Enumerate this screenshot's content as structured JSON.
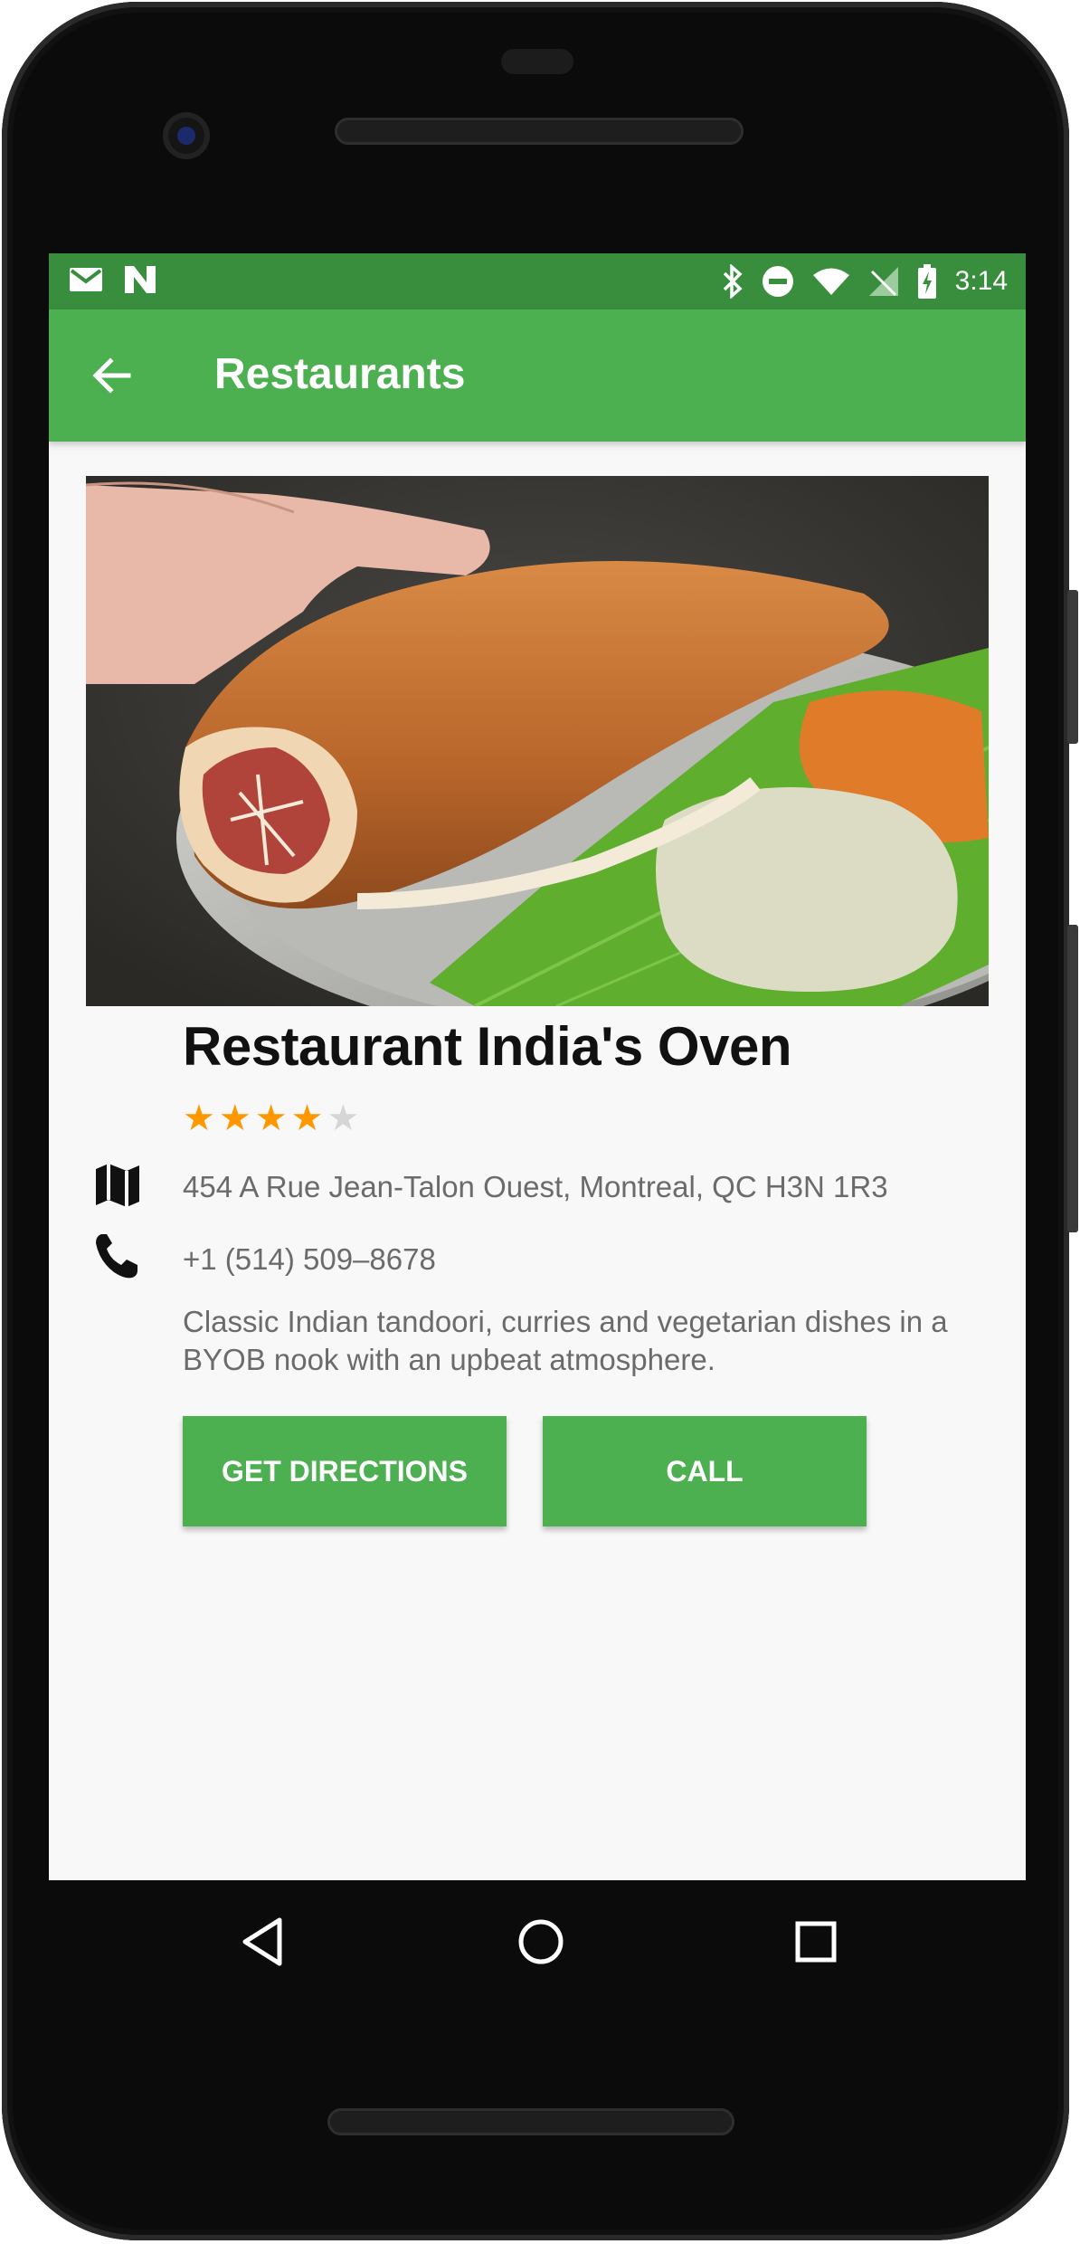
{
  "status_bar": {
    "time": "3:14",
    "icons_left": [
      "gmail-icon",
      "n-notification-icon"
    ],
    "icons_right": [
      "bluetooth-icon",
      "do-not-disturb-icon",
      "wifi-icon",
      "no-signal-icon",
      "battery-charging-icon"
    ]
  },
  "app_bar": {
    "title": "Restaurants",
    "back_icon": "arrow-back-icon",
    "color": "#4caf50",
    "status_color": "#388e3c"
  },
  "restaurant": {
    "name": "Restaurant India's Oven",
    "rating": 4,
    "rating_max": 5,
    "address": "454 A Rue Jean-Talon Ouest, Montreal, QC H3N 1R3",
    "phone": "+1 (514) 509–8678",
    "description": "Classic Indian tandoori, curries and vegetarian dishes in a BYOB nook with an upbeat atmosphere.",
    "image": "masala-dosa-photo"
  },
  "actions": {
    "directions_label": "GET DIRECTIONS",
    "call_label": "CALL"
  },
  "nav_bar": {
    "items": [
      "back-triangle-icon",
      "home-circle-icon",
      "recents-square-icon"
    ]
  },
  "colors": {
    "accent": "#4caf50",
    "star_filled": "#ff9800",
    "star_empty": "#d6d6d6"
  }
}
